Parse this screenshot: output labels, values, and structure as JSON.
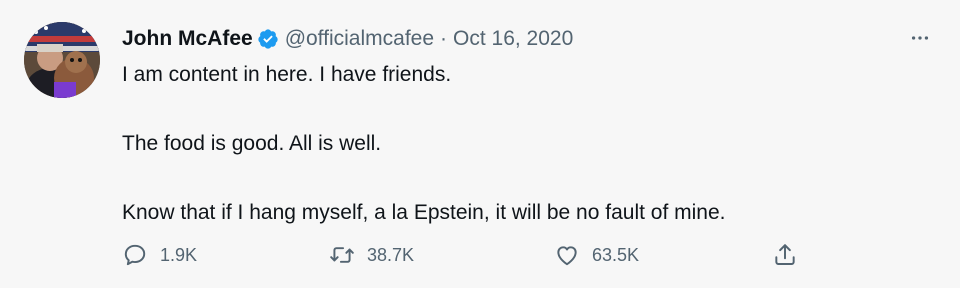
{
  "tweet": {
    "author": {
      "name": "John McAfee",
      "handle": "@officialmcafee",
      "verified_icon": "verified-badge-icon"
    },
    "separator": "·",
    "date": "Oct 16, 2020",
    "text_lines": [
      "I am content in here. I have friends.",
      "The food is good. All is well.",
      "Know that if I hang myself, a la Epstein, it will be no fault of mine."
    ],
    "actions": {
      "replies": "1.9K",
      "retweets": "38.7K",
      "likes": "63.5K"
    },
    "more_icon": "more-horizontal-icon"
  },
  "colors": {
    "background": "#f7f7f7",
    "text_primary": "#0f1419",
    "text_secondary": "#536471",
    "verified": "#1d9bf0"
  }
}
